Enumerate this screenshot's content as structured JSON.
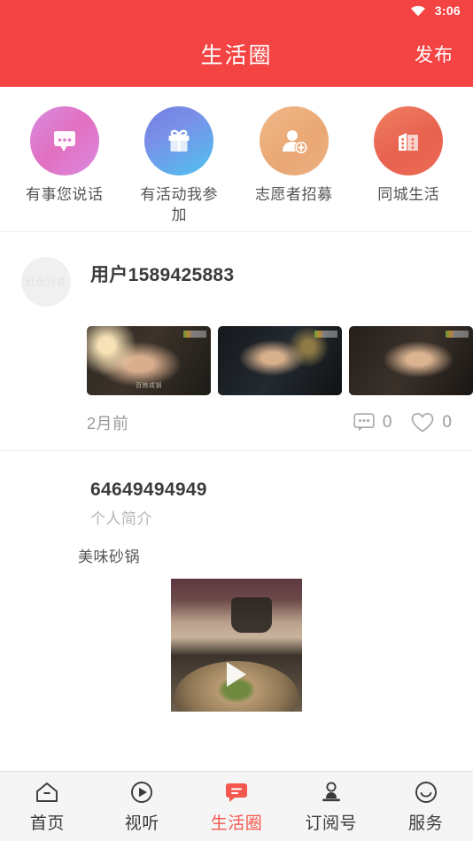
{
  "status_bar": {
    "time": "3:06",
    "wifi_icon": "wifi-icon"
  },
  "app_bar": {
    "title": "生活圈",
    "publish_label": "发布"
  },
  "theme": {
    "primary": "#F44343",
    "active_nav": "#F4574E",
    "body_text": "#3b3b3b",
    "muted_text": "#9a9a9a"
  },
  "shortcuts": [
    {
      "label": "有事您说话",
      "icon": "speech-bubble-icon"
    },
    {
      "label": "有活动我参加",
      "icon": "gift-icon"
    },
    {
      "label": "志愿者招募",
      "icon": "person-add-icon"
    },
    {
      "label": "同城生活",
      "icon": "building-icon"
    }
  ],
  "posts": [
    {
      "username": "用户1589425883",
      "avatar_watermark": "红色兴县",
      "time": "2月前",
      "comment_count": "0",
      "like_count": "0",
      "thumbnails": [
        {
          "caption": "百炼成钢"
        },
        {
          "caption": ""
        },
        {
          "caption": ""
        }
      ]
    },
    {
      "username": "64649494949",
      "subtitle": "个人简介",
      "text": "美味砂锅"
    }
  ],
  "bottom_nav": [
    {
      "label": "首页",
      "icon": "home-icon",
      "active": false
    },
    {
      "label": "视听",
      "icon": "play-circle-icon",
      "active": false
    },
    {
      "label": "生活圈",
      "icon": "chat-bubble-icon",
      "active": true
    },
    {
      "label": "订阅号",
      "icon": "stamp-icon",
      "active": false
    },
    {
      "label": "服务",
      "icon": "smiley-icon",
      "active": false
    }
  ]
}
